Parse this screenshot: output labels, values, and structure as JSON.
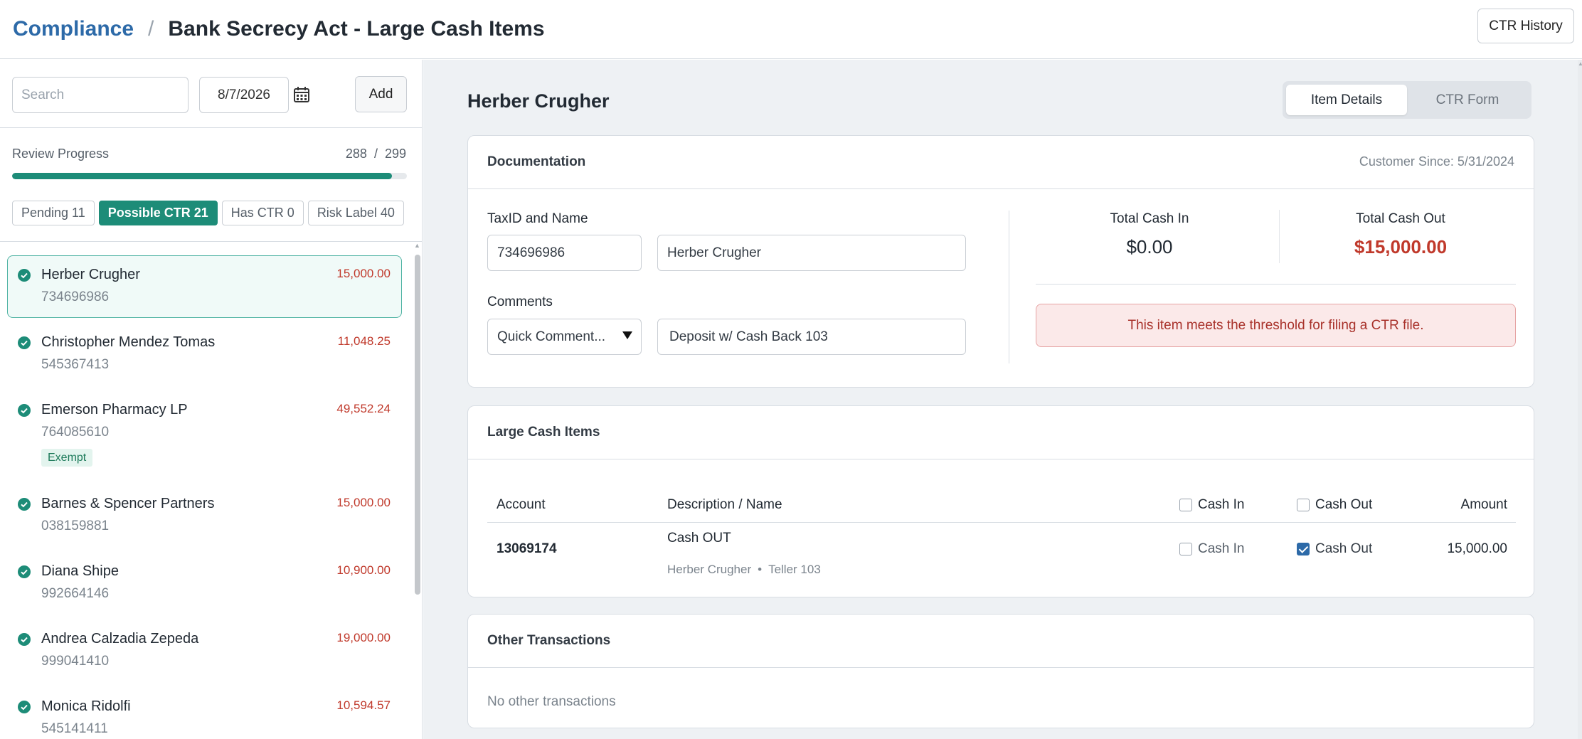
{
  "header": {
    "breadcrumb_root": "Compliance",
    "breadcrumb_sep": "/",
    "breadcrumb_current": "Bank Secrecy Act - Large Cash Items",
    "history_button": "CTR History"
  },
  "sidebar": {
    "search_placeholder": "Search",
    "date_value": "8/7/2026",
    "add_label": "Add",
    "progress_label": "Review Progress",
    "progress_done": "288",
    "progress_total": "299",
    "progress_fraction": 0.963,
    "filters": [
      {
        "label": "Pending 11"
      },
      {
        "label": "Possible CTR 21"
      },
      {
        "label": "Has CTR 0"
      },
      {
        "label": "Risk Label 40"
      }
    ],
    "items": [
      {
        "name": "Herber Crugher",
        "id": "734696986",
        "amount": "15,000.00"
      },
      {
        "name": "Christopher Mendez Tomas",
        "id": "545367413",
        "amount": "11,048.25"
      },
      {
        "name": "Emerson Pharmacy LP",
        "id": "764085610",
        "amount": "49,552.24",
        "badge": "Exempt"
      },
      {
        "name": "Barnes & Spencer Partners",
        "id": "038159881",
        "amount": "15,000.00"
      },
      {
        "name": "Diana Shipe",
        "id": "992664146",
        "amount": "10,900.00"
      },
      {
        "name": "Andrea Calzadia Zepeda",
        "id": "999041410",
        "amount": "19,000.00"
      },
      {
        "name": "Monica Ridolfi",
        "id": "545141411",
        "amount": "10,594.57"
      }
    ]
  },
  "main": {
    "person_name": "Herber Crugher",
    "tabs": [
      {
        "label": "Item Details"
      },
      {
        "label": "CTR Form"
      }
    ],
    "documentation": {
      "title": "Documentation",
      "customer_since": "Customer Since: 5/31/2024",
      "taxid_label": "TaxID and Name",
      "taxid_value": "734696986",
      "name_value": "Herber Crugher",
      "comments_label": "Comments",
      "quick_comment": "Quick Comment...",
      "comment_value": "Deposit w/ Cash Back 103",
      "total_in_label": "Total Cash In",
      "total_in_value": "$0.00",
      "total_out_label": "Total Cash Out",
      "total_out_value": "$15,000.00",
      "alert": "This item meets the threshold for filing a CTR file."
    },
    "large_cash": {
      "title": "Large Cash Items",
      "col_account": "Account",
      "col_desc": "Description / Name",
      "col_cash_in": "Cash In",
      "col_cash_out": "Cash Out",
      "col_amount": "Amount",
      "row": {
        "account": "13069174",
        "desc": "Cash OUT",
        "sub_name": "Herber Crugher",
        "sub_sep": "•",
        "sub_teller": "Teller 103",
        "cash_in": "Cash In",
        "cash_out": "Cash Out",
        "amount": "15,000.00"
      }
    },
    "other": {
      "title": "Other Transactions",
      "empty": "No other transactions"
    }
  },
  "colors": {
    "accent": "#1d8c78",
    "link": "#2d6aa8",
    "danger": "#c0392b"
  }
}
